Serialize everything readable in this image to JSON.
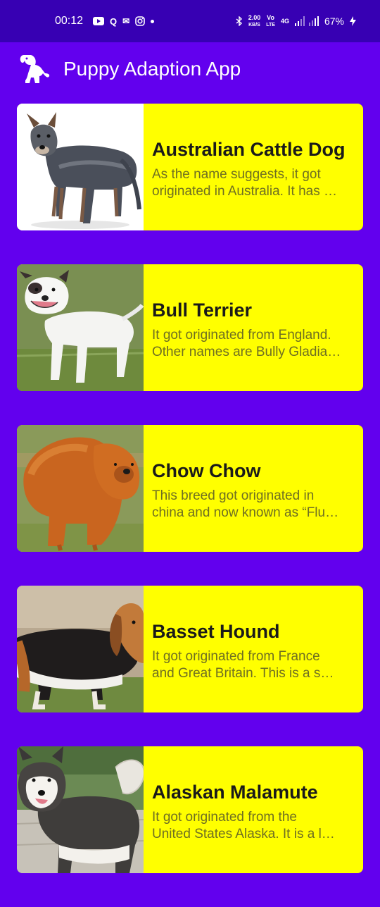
{
  "status": {
    "time": "00:12",
    "speed_value": "2.00",
    "speed_unit": "KB/S",
    "volte_top": "Vo",
    "volte_bottom": "LTE",
    "network": "4G",
    "battery": "67%",
    "icons": [
      "youtube-icon",
      "q-icon",
      "mail-icon",
      "instagram-icon",
      "dot-icon",
      "bluetooth-icon",
      "signal-icon",
      "battery-charging-icon"
    ]
  },
  "app": {
    "title": "Puppy Adaption App",
    "logo_icon": "dog-logo-icon"
  },
  "dogs": [
    {
      "name": "Australian Cattle Dog",
      "desc_line1": "As the name suggests, it got",
      "desc_line2": "originated in Australia. It has …"
    },
    {
      "name": "Bull Terrier",
      "desc_line1": "It got originated from England.",
      "desc_line2": "Other names are Bully Gladia…"
    },
    {
      "name": "Chow Chow",
      "desc_line1": "This breed got originated in",
      "desc_line2": "china and now known as “Flu…"
    },
    {
      "name": "Basset Hound",
      "desc_line1": "It got originated from France",
      "desc_line2": "and Great Britain. This is a s…"
    },
    {
      "name": "Alaskan Malamute",
      "desc_line1": "It got originated from the",
      "desc_line2": "United States Alaska. It is a l…"
    }
  ],
  "colors": {
    "background": "#6200EE",
    "statusbar": "#3700B3",
    "card": "#FFFF00",
    "title_text": "#1a1a1a",
    "desc_text": "#6f6f22"
  }
}
